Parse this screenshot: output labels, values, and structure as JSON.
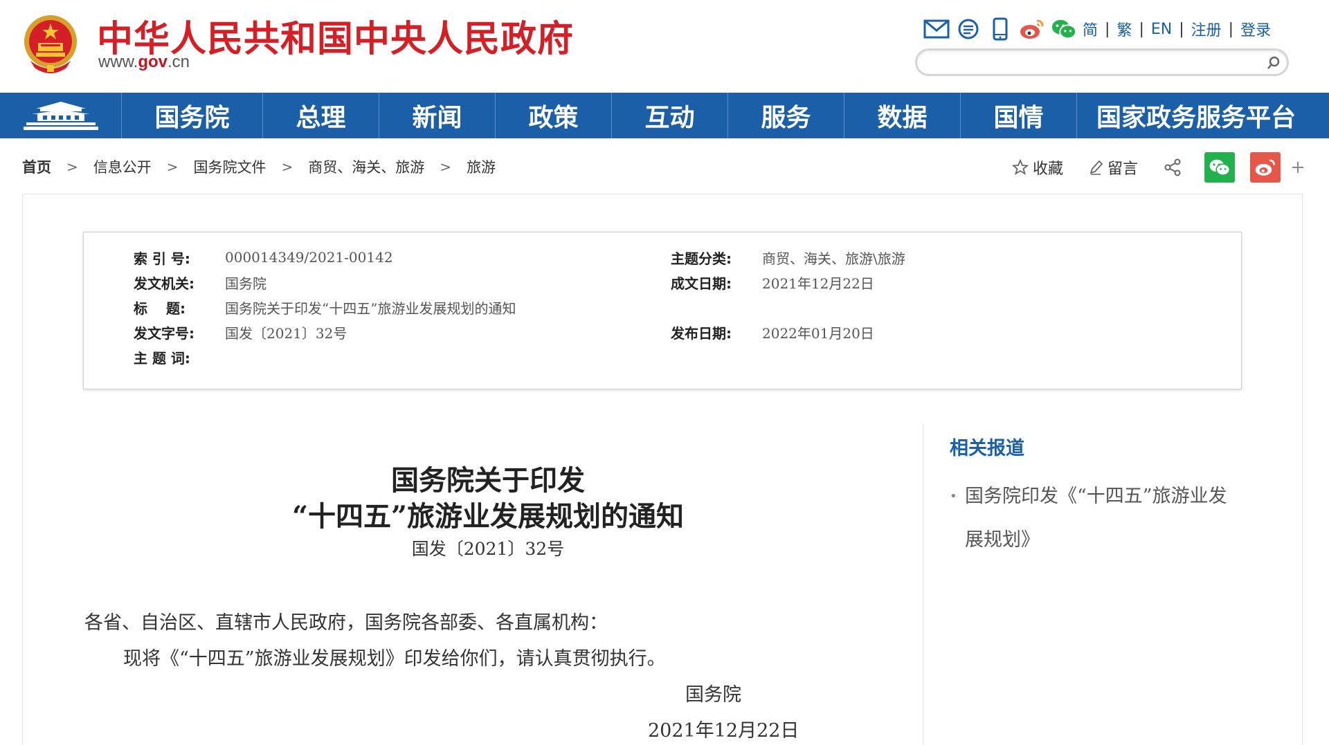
{
  "header": {
    "site_title": "中华人民共和国中央人民政府",
    "site_url_pre": "www.",
    "site_url_brand": "gov",
    "site_url_post": ".cn",
    "links": [
      "简",
      "繁",
      "EN",
      "注册",
      "登录"
    ],
    "search_placeholder": ""
  },
  "nav": {
    "items": [
      "国务院",
      "总理",
      "新闻",
      "政策",
      "互动",
      "服务",
      "数据",
      "国情",
      "国家政务服务平台"
    ]
  },
  "breadcrumb": [
    "首页",
    "信息公开",
    "国务院文件",
    "商贸、海关、旅游",
    "旅游"
  ],
  "share": {
    "favorite_label": "收藏",
    "comment_label": "留言"
  },
  "meta": {
    "index_label": "索 引 号:",
    "index_value": "000014349/2021-00142",
    "issuer_label": "发文机关:",
    "issuer_value": "国务院",
    "title_label": "标　 题:",
    "title_value": "国务院关于印发“十四五”旅游业发展规划的通知",
    "doc_number_label": "发文字号:",
    "doc_number_value": "国发〔2021〕32号",
    "keywords_label": "主 题 词:",
    "keywords_value": "",
    "category_label": "主题分类:",
    "category_value": "商贸、海关、旅游\\旅游",
    "written_date_label": "成文日期:",
    "written_date_value": "2021年12月22日",
    "publish_date_label": "发布日期:",
    "publish_date_value": "2022年01月20日"
  },
  "article": {
    "title_line1": "国务院关于印发",
    "title_line2": "“十四五”旅游业发展规划的通知",
    "doc_number": "国发〔2021〕32号",
    "salutation": "各省、自治区、直辖市人民政府，国务院各部委、各直属机构：",
    "body": "现将《“十四五”旅游业发展规划》印发给你们，请认真贯彻执行。",
    "signature": "国务院",
    "date": "2021年12月22日"
  },
  "related": {
    "title": "相关报道",
    "items": [
      "国务院印发《“十四五”旅游业发展规划》"
    ]
  },
  "colors": {
    "brand_red": "#d31f25",
    "nav_blue": "#1a5fa8",
    "wechat_green": "#22b14c",
    "weibo_red": "#e6574a"
  }
}
